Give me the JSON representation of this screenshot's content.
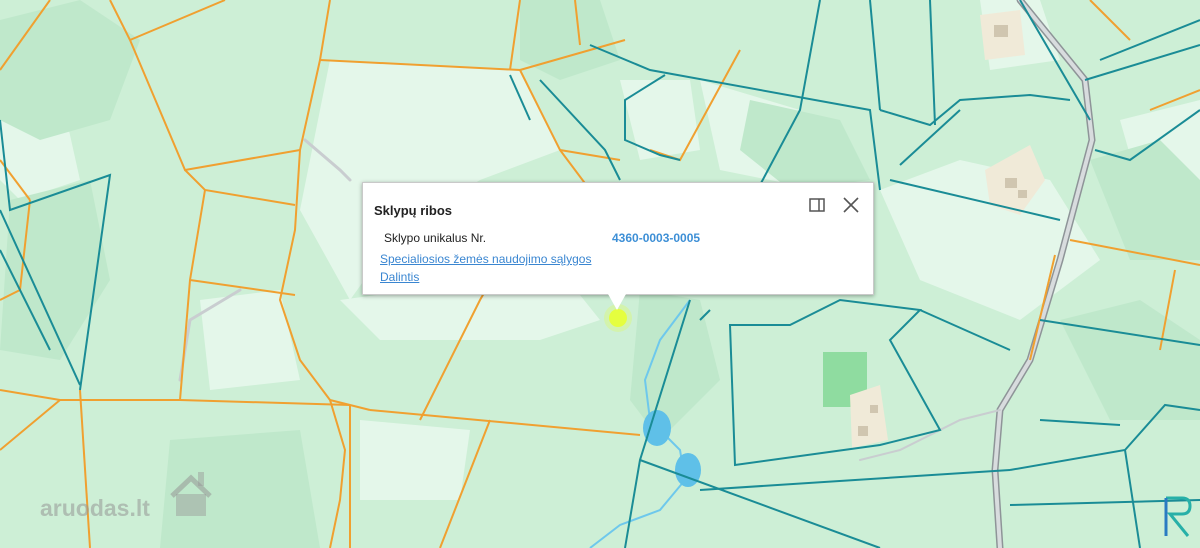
{
  "popup": {
    "title": "Sklypų ribos",
    "row_label": "Sklypo unikalus Nr.",
    "row_value": "4360-0003-0005",
    "link_1": "Specialiosios žemės naudojimo sąlygos",
    "link_2": "Dalintis"
  },
  "watermark": {
    "text": "aruodas",
    "suffix": ".lt"
  },
  "icons": {
    "maximize": "maximize-icon",
    "close": "close-icon"
  },
  "colors": {
    "base": "#cdefd6",
    "forest": "#e3f6e8",
    "orange_boundary": "#f0a030",
    "teal_boundary": "#1a8c96",
    "water": "#5fc0e8",
    "road": "#b4b8bc",
    "marker": "#e8ff33"
  }
}
